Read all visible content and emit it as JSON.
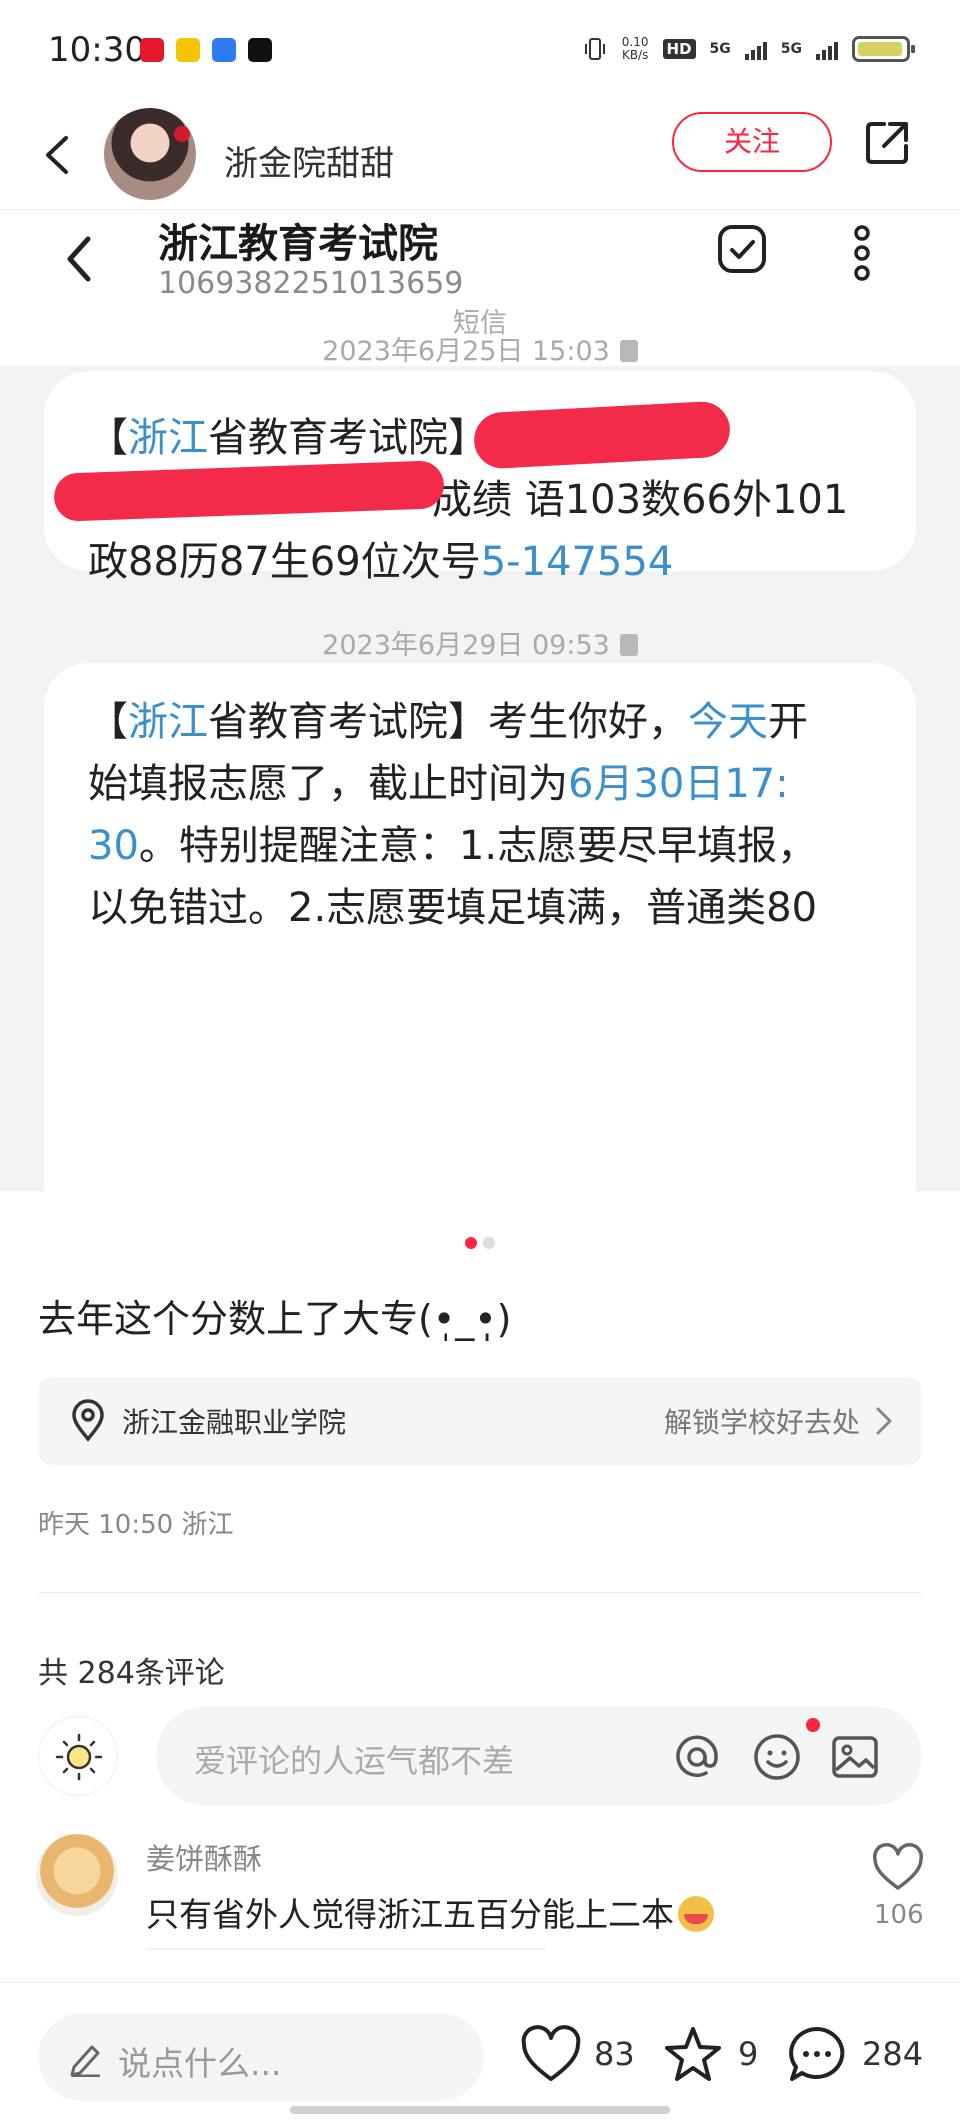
{
  "status_bar": {
    "time": "10:30",
    "net_speed_value": "0.10",
    "net_speed_unit": "KB/s",
    "hd_label": "HD",
    "sim1": "5G",
    "sim2": "5G",
    "app_icons": [
      "weibo-app",
      "yellow-app",
      "baidu-app",
      "tiktok-app"
    ]
  },
  "top_nav": {
    "username": "浙金院甜甜",
    "follow_label": "关注"
  },
  "sms": {
    "title": "浙江教育考试院",
    "number": "1069382251013659",
    "message_type": "短信",
    "messages": [
      {
        "date": "2023年6月25日 15:03",
        "line1_bracket_l": "【",
        "line1_hl": "浙江",
        "line1_rest": "省教育考试院】.",
        "line2": "成绩 语103数66外101",
        "line3_plain": "政88历87生69位次号",
        "line3_hl": "5-147554"
      },
      {
        "date": "2023年6月29日 09:53",
        "line1_bracket_l": "【",
        "line1_hl": "浙江",
        "line1_rest": "省教育考试院】考生你好，",
        "line1_hl2": "今天",
        "line1_tail": "开",
        "line2_plain": "始填报志愿了，截止时间为",
        "line2_hl": "6月30日17:",
        "line3_hl": "30",
        "line3_rest": "。特别提醒注意：1.志愿要尽早填报，",
        "line4": "以免错过。2.志愿要填足填满，普通类80"
      }
    ]
  },
  "post": {
    "caption": "去年这个分数上了大专(•̩̩̩̩_•̩̩̩̩)",
    "location_name": "浙江金融职业学院",
    "location_action": "解锁学校好去处",
    "meta": "昨天 10:50 浙江",
    "comment_count": "共 284条评论",
    "comment_placeholder": "爱评论的人运气都不差"
  },
  "comments": [
    {
      "user": "姜饼酥酥",
      "text": "只有省外人觉得浙江五百分能上二本",
      "likes": "106"
    }
  ],
  "bottom_bar": {
    "input_placeholder": "说点什么...",
    "likes": "83",
    "favorites": "9",
    "comments": "284"
  },
  "colors": {
    "accent": "#ff2442",
    "link": "#3a8fcc",
    "redaction": "#f42a4a"
  }
}
